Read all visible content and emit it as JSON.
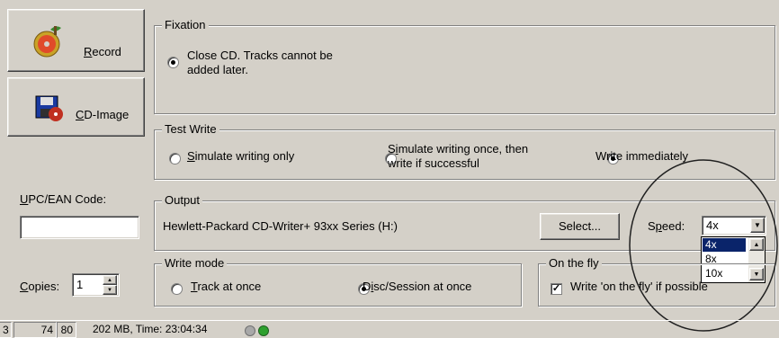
{
  "buttons": {
    "record": {
      "label_pre": "",
      "label_u": "R",
      "label_post": "ecord"
    },
    "cd_image": {
      "label_pre": "",
      "label_u": "C",
      "label_post": "D-Image"
    }
  },
  "fixation": {
    "title": "Fixation",
    "option_line1": "Close CD. Tracks cannot be",
    "option_line2": "added later."
  },
  "test_write": {
    "title": "Test Write",
    "opt1_u": "S",
    "opt1_rest": "imulate writing only",
    "opt2_line1_pre": "S",
    "opt2_line1_u": "i",
    "opt2_line1_post": "mulate writing once, then",
    "opt2_line2": "write if successful",
    "opt3": "Write immediately",
    "selected": "Write immediately"
  },
  "upc": {
    "label_u": "U",
    "label_rest": "PC/EAN Code:",
    "value": ""
  },
  "copies": {
    "label_u": "C",
    "label_rest": "opies:",
    "value": "1"
  },
  "output": {
    "title": "Output",
    "device": "Hewlett-Packard CD-Writer+ 93xx Series (H:)",
    "select_label": "Select..."
  },
  "speed": {
    "label_pre": "S",
    "label_u": "p",
    "label_post": "eed:",
    "value": "4x",
    "options": [
      "4x",
      "8x",
      "10x"
    ],
    "highlighted": "4x"
  },
  "write_mode": {
    "title": "Write mode",
    "opt1_u": "T",
    "opt1_rest": "rack at once",
    "opt2_pre": "D",
    "opt2_u": "i",
    "opt2_post": "sc/Session at once",
    "selected": "Disc/Session at once"
  },
  "on_the_fly": {
    "title": "On the fly",
    "checkbox_label": "Write 'on the fly' if possible",
    "checked": true
  },
  "statusbar": {
    "cell1": "3",
    "cell2": "74",
    "cell3": "80",
    "info": "202 MB, Time: 23:04:34"
  },
  "colors": {
    "face": "#d4d0c8",
    "highlight": "#0a246a"
  }
}
